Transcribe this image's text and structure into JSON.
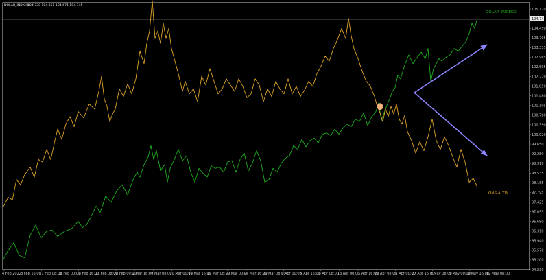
{
  "header": {
    "symbol": "DOLAR_INDX,H4",
    "ohlc": "104.730 104.851 104.671 104.745"
  },
  "colors": {
    "background": "#000000",
    "frame": "#ffffff",
    "dollar": "#1fae1f",
    "gold": "#e0a52a",
    "arrow": "#8b85ff",
    "marker": "#f0b27a",
    "current_price_bg": "#e8e8e8"
  },
  "chart_data": {
    "type": "line",
    "title": "",
    "y_axis_labels": [
      "105.170",
      "104.745",
      "104.450",
      "103.705",
      "103.335",
      "102.965",
      "102.595",
      "102.220",
      "101.850",
      "101.480",
      "101.105",
      "100.760",
      "100.390",
      "100.020",
      "99.650",
      "99.280",
      "98.910",
      "98.535",
      "98.165",
      "97.795",
      "97.425",
      "97.055",
      "96.680",
      "96.310",
      "95.940",
      "95.570",
      "95.200",
      "94.830"
    ],
    "current_price": "104.745",
    "ylim": [
      94.83,
      105.17
    ],
    "x_axis_labels": [
      "4 Feb 2022",
      "8 Feb 16:00",
      "11 Feb 08:00",
      "16 Feb 00:00",
      "18 Feb 16:00",
      "23 Feb 08:00",
      "28 Feb 00:00",
      "2 Mar 16:00",
      "7 Mar 08:00",
      "10 Mar 00:00",
      "14 Mar 16:00",
      "17 Mar 08:00",
      "22 Mar 00:00",
      "24 Mar 16:00",
      "29 Mar 08:00",
      "1 Apr 00:00",
      "5 Apr 16:00",
      "8 Apr 08:00",
      "13 Apr 00:00",
      "15 Apr 16:00",
      "20 Apr 08:00",
      "25 Apr 00:00",
      "27 Apr 16:00",
      "2 May 08:00",
      "5 May 00:00",
      "9 May 16:00",
      "12 May 08:00"
    ],
    "series": [
      {
        "name": "DOLAR ENDEKSİ",
        "x": [
          0,
          8,
          16,
          24,
          32,
          40,
          48,
          56,
          64,
          72,
          80,
          90,
          100,
          110,
          116,
          122,
          128,
          136,
          142,
          150,
          158,
          166,
          174,
          182,
          190,
          196,
          200,
          206,
          212,
          216,
          220,
          224,
          230,
          236,
          240,
          244,
          250,
          256,
          262,
          268,
          274,
          280,
          286,
          292,
          298,
          304,
          310,
          316,
          322,
          328,
          334,
          340,
          346,
          352,
          358,
          364,
          370,
          376,
          382,
          388,
          394,
          400,
          406,
          412,
          418,
          424,
          430,
          436,
          442,
          448,
          454,
          460,
          466,
          472,
          478,
          484,
          490,
          496,
          502,
          508,
          514,
          520,
          526,
          532,
          538,
          544,
          548,
          552,
          556,
          560,
          564,
          568,
          572,
          576,
          580,
          586,
          592,
          598,
          604,
          610,
          616,
          620,
          624,
          628,
          632,
          636,
          640,
          646,
          652,
          658,
          664,
          670,
          676,
          680,
          684,
          688,
          692
        ],
        "y": [
          95.2,
          95.6,
          95.9,
          95.4,
          95.3,
          96.2,
          96.6,
          96.1,
          96.35,
          96.4,
          96.15,
          96.35,
          96.45,
          96.75,
          96.5,
          96.6,
          96.9,
          97.35,
          97.1,
          97.75,
          97.5,
          97.95,
          98.2,
          97.8,
          98.4,
          98.7,
          98.5,
          99.0,
          99.3,
          99.75,
          99.2,
          99.55,
          98.75,
          99.0,
          98.3,
          98.85,
          99.2,
          99.6,
          99.15,
          99.35,
          98.7,
          98.3,
          98.85,
          98.65,
          98.5,
          98.95,
          98.85,
          98.9,
          98.7,
          99.1,
          99.15,
          98.7,
          99.2,
          99.45,
          98.75,
          99.05,
          99.55,
          99.15,
          98.3,
          98.4,
          98.85,
          98.7,
          99.05,
          99.25,
          99.35,
          99.75,
          99.6,
          100.0,
          99.7,
          99.95,
          100.05,
          99.85,
          100.2,
          100.25,
          100.15,
          100.4,
          100.2,
          100.45,
          100.6,
          100.5,
          100.8,
          100.7,
          101.05,
          100.55,
          100.9,
          101.1,
          101.45,
          100.75,
          101.05,
          101.35,
          101.6,
          101.9,
          102.05,
          102.55,
          102.4,
          102.95,
          103.35,
          103.0,
          103.25,
          103.45,
          103.2,
          103.6,
          102.3,
          102.8,
          103.0,
          103.2,
          103.1,
          103.25,
          103.35,
          103.6,
          103.5,
          103.7,
          103.9,
          104.2,
          104.6,
          104.4,
          104.8
        ]
      },
      {
        "name": "ONS ALTIN",
        "x": [
          0,
          8,
          14,
          20,
          26,
          32,
          40,
          46,
          52,
          58,
          64,
          70,
          76,
          80,
          86,
          92,
          98,
          104,
          110,
          118,
          126,
          134,
          140,
          144,
          148,
          152,
          156,
          160,
          164,
          170,
          176,
          182,
          188,
          194,
          200,
          206,
          210,
          214,
          218,
          222,
          226,
          230,
          234,
          238,
          242,
          246,
          250,
          256,
          262,
          266,
          272,
          278,
          284,
          290,
          296,
          302,
          308,
          314,
          320,
          326,
          332,
          338,
          344,
          350,
          356,
          362,
          368,
          374,
          380,
          386,
          392,
          398,
          404,
          410,
          416,
          422,
          428,
          434,
          440,
          446,
          452,
          458,
          464,
          470,
          476,
          482,
          488,
          494,
          500,
          504,
          508,
          512,
          518,
          524,
          530,
          536,
          542,
          546,
          550,
          554,
          558,
          562,
          566,
          570,
          574,
          578,
          582,
          586,
          590,
          596,
          602,
          608,
          614,
          620,
          626,
          632,
          638,
          644,
          650,
          656,
          662,
          668,
          674,
          680,
          686,
          692
        ],
        "y": [
          97.3,
          97.7,
          97.6,
          98.4,
          98.2,
          98.6,
          98.9,
          98.5,
          99.2,
          99.1,
          99.6,
          99.2,
          99.95,
          100.4,
          100.0,
          100.6,
          100.9,
          100.5,
          101.1,
          100.85,
          101.4,
          101.2,
          101.9,
          102.5,
          101.6,
          101.3,
          100.7,
          101.0,
          101.2,
          102.0,
          101.7,
          102.2,
          101.8,
          102.4,
          103.5,
          103.0,
          103.8,
          104.3,
          105.5,
          104.0,
          104.3,
          103.8,
          104.6,
          104.0,
          104.4,
          103.6,
          103.2,
          102.6,
          101.9,
          102.3,
          101.8,
          102.0,
          101.5,
          102.5,
          102.15,
          102.8,
          102.3,
          101.8,
          102.0,
          102.4,
          102.15,
          101.9,
          102.4,
          102.1,
          101.65,
          101.8,
          102.4,
          102.15,
          101.5,
          102.0,
          101.7,
          102.3,
          102.0,
          101.8,
          102.4,
          101.8,
          102.1,
          101.7,
          101.95,
          102.3,
          102.1,
          102.6,
          102.9,
          103.3,
          103.1,
          103.6,
          103.95,
          104.4,
          104.0,
          104.8,
          104.1,
          103.6,
          103.2,
          102.7,
          102.3,
          102.1,
          101.7,
          101.3,
          101.05,
          100.7,
          101.2,
          100.9,
          101.3,
          101.0,
          101.4,
          100.8,
          100.6,
          100.95,
          100.3,
          99.95,
          99.45,
          99.9,
          99.55,
          100.1,
          100.8,
          99.95,
          99.6,
          100.1,
          99.75,
          99.3,
          98.9,
          99.6,
          99.1,
          98.3,
          98.45,
          98.1
        ]
      }
    ],
    "annotations": {
      "dollar_label": "DOLAR ENDEKSİ",
      "gold_label": "ONS ALTIN",
      "intersection": {
        "x": 550,
        "y": 101.3
      },
      "arrow_up": {
        "from": [
          600,
          101.85
        ],
        "to": [
          706,
          103.75
        ]
      },
      "arrow_down": {
        "from": [
          600,
          101.85
        ],
        "to": [
          706,
          99.35
        ]
      }
    }
  }
}
